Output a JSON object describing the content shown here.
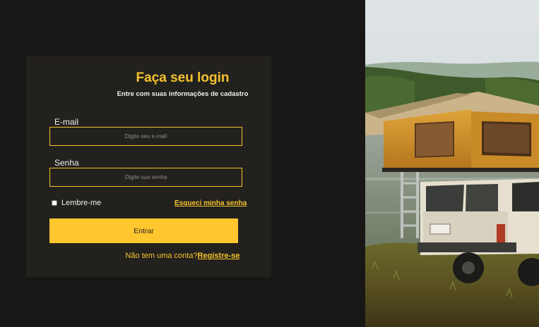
{
  "login": {
    "title": "Faça seu login",
    "subtitle": "Entre com suas informações de cadastro",
    "email_label": "E-mail",
    "email_placeholder": "Digite seu e-mail",
    "password_label": "Senha",
    "password_placeholder": "Digite sua senha",
    "remember_label": "Lembre-me",
    "remember_checked": false,
    "forgot_label": "Esqueci minha senha",
    "submit_label": "Entrar",
    "signup_prompt": "Não tem uma conta?",
    "signup_link": "Registre-se"
  },
  "theme": {
    "background": "#181716",
    "card": "#23211e",
    "accent": "#f5c32c",
    "button": "#ffc62e"
  },
  "photo": {
    "icon": "car-with-rooftop-tent-photo"
  }
}
